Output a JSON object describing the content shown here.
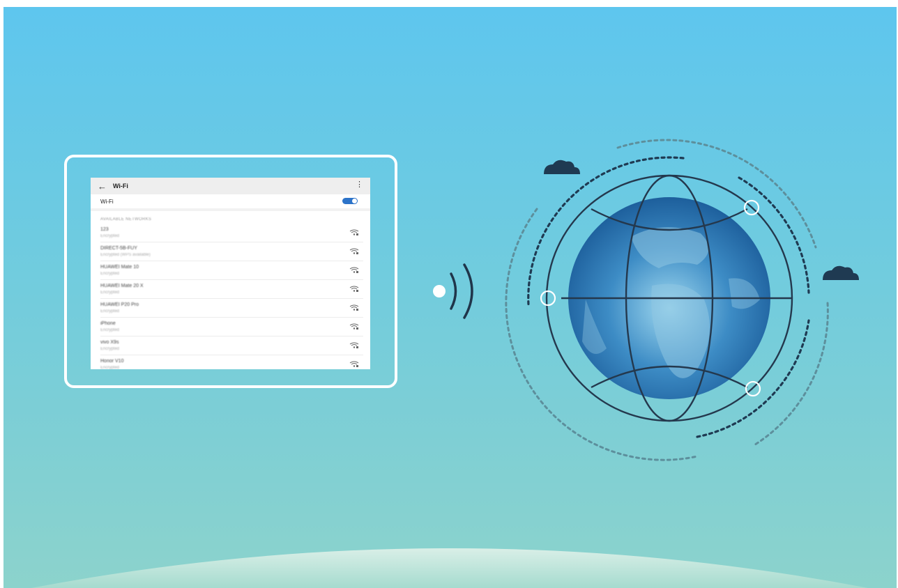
{
  "wifi_settings": {
    "title": "Wi-Fi",
    "toggle_label": "Wi-Fi",
    "toggle_on": true,
    "section_header": "AVAILABLE NETWORKS",
    "networks": [
      {
        "name": "123",
        "status": "Encrypted"
      },
      {
        "name": "DIRECT-5B-FUY",
        "status": "Encrypted (WPS available)"
      },
      {
        "name": "HUAWEI Mate 10",
        "status": "Encrypted"
      },
      {
        "name": "HUAWEI Mate 20 X",
        "status": "Encrypted"
      },
      {
        "name": "HUAWEI P20 Pro",
        "status": "Encrypted"
      },
      {
        "name": "iPhone",
        "status": "Encrypted"
      },
      {
        "name": "vivo X9s",
        "status": "Encrypted"
      },
      {
        "name": "Honor V10",
        "status": "Encrypted"
      }
    ],
    "icons": {
      "back": "back-arrow-icon",
      "menu": "more-vertical-icon",
      "signal": "wifi-signal-lock-icon"
    },
    "accent_color": "#2c73c9"
  },
  "illustration": {
    "background_colors": [
      "#5ec6ee",
      "#8cd3cc"
    ],
    "icons": [
      "broadcast-signal-icon",
      "globe-icon",
      "cloud-icon"
    ]
  }
}
